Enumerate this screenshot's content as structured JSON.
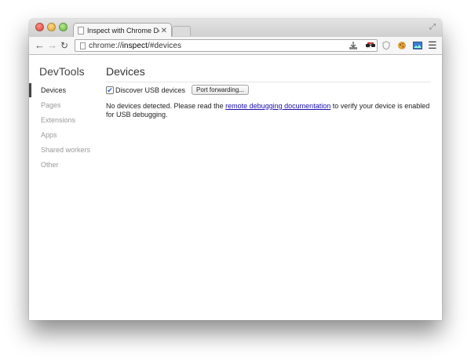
{
  "browser": {
    "tab_title": "Inspect with Chrome Devel",
    "tab_close": "✕",
    "url_scheme": "chrome://",
    "url_host": "inspect",
    "url_path": "/#devices",
    "icons": [
      "back-arrow-icon",
      "forward-arrow-icon",
      "reload-icon",
      "bookmark-star-icon",
      "extension-icons",
      "menu-icon"
    ]
  },
  "sidebar": {
    "title": "DevTools",
    "items": [
      {
        "label": "Devices"
      },
      {
        "label": "Pages"
      },
      {
        "label": "Extensions"
      },
      {
        "label": "Apps"
      },
      {
        "label": "Shared workers"
      },
      {
        "label": "Other"
      }
    ]
  },
  "main": {
    "title": "Devices",
    "discover_usb_label": "Discover USB devices",
    "discover_usb_checked": true,
    "port_forwarding_label": "Port forwarding...",
    "message_before": "No devices detected. Please read the ",
    "message_link": "remote debugging documentation",
    "message_after": " to verify your device is enabled for USB debugging."
  },
  "colors": {
    "link": "#1a0dab",
    "selected_indicator": "#444444"
  }
}
